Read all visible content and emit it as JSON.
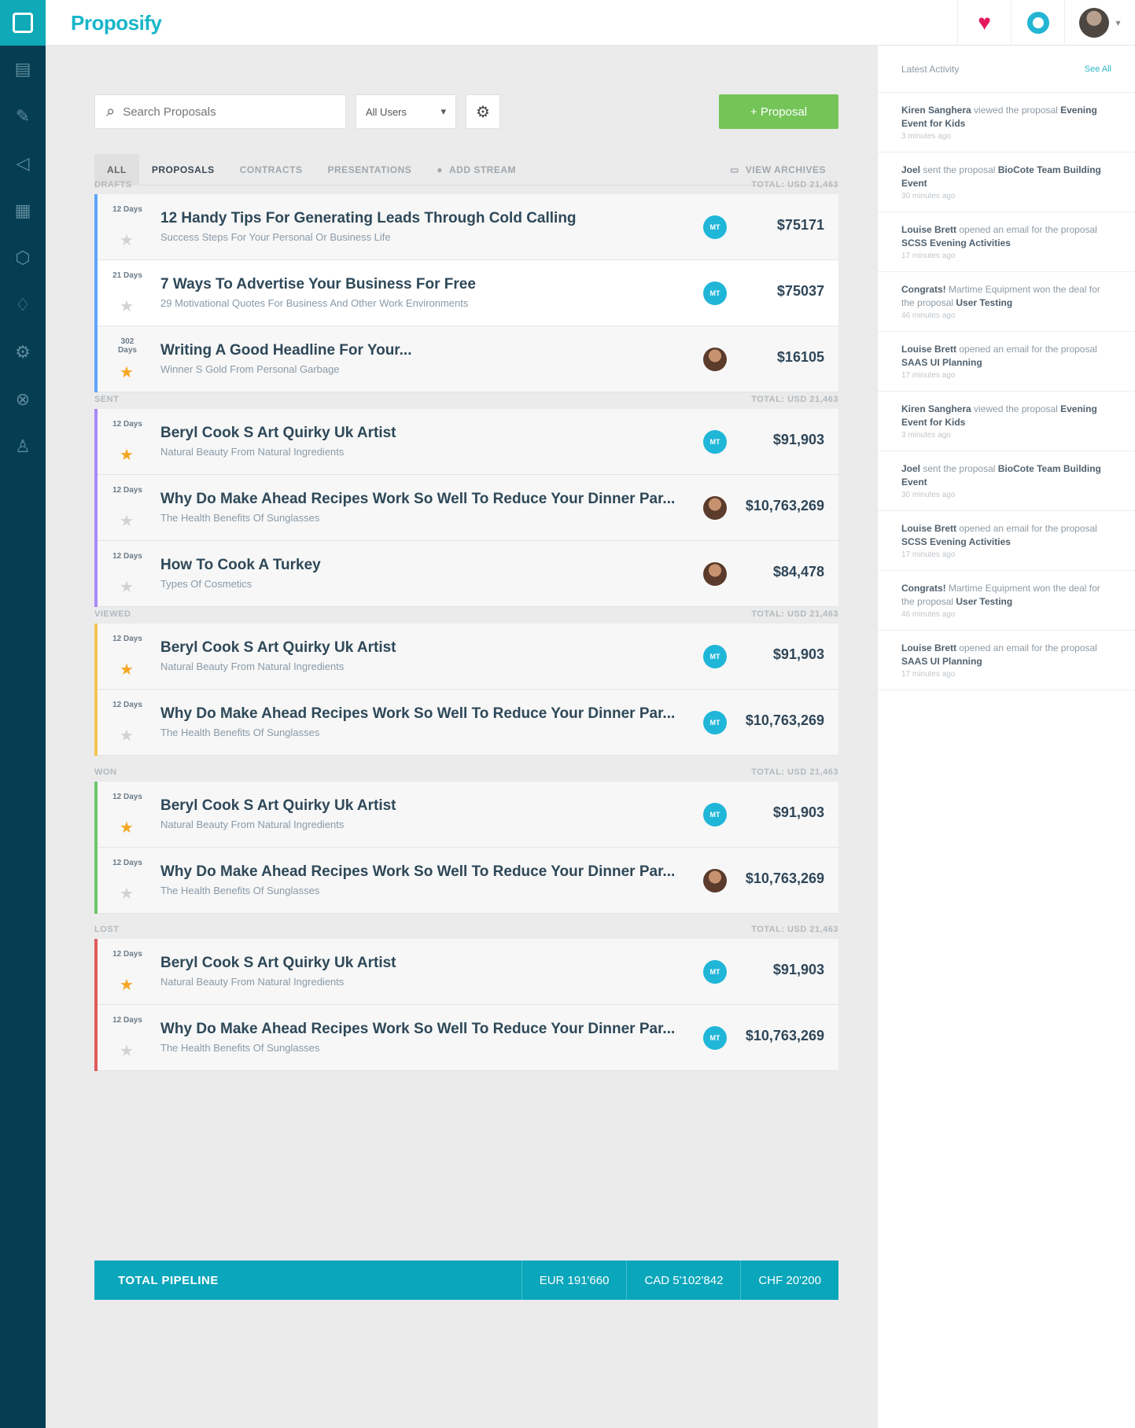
{
  "brand": "Proposify",
  "sidebar": {
    "icons": [
      "dashboard-icon",
      "pen-tool-icon",
      "megaphone-icon",
      "grid-icon",
      "box-icon",
      "lightbulb-icon",
      "settings-icon",
      "help-icon",
      "user-icon"
    ]
  },
  "toolbar": {
    "search_placeholder": "Search Proposals",
    "user_filter": "All Users",
    "new_button": "+ Proposal"
  },
  "tabs": [
    {
      "label": "ALL"
    },
    {
      "label": "PROPOSALS"
    },
    {
      "label": "CONTRACTS"
    },
    {
      "label": "PRESENTATIONS"
    },
    {
      "label": "ADD STREAM"
    },
    {
      "label": "VIEW ARCHIVES"
    }
  ],
  "groups": [
    {
      "name": "DRAFTS",
      "total": "TOTAL: USD 21,463",
      "color": "#60a5fa",
      "rows": [
        {
          "days": "12 Days",
          "title": "12 Handy Tips For Generating Leads Through Cold Calling",
          "subtitle": "Success Steps For Your Personal Or Business Life",
          "amount": "$75171",
          "starred": false,
          "owner": "MT"
        },
        {
          "days": "21 Days",
          "title": "7 Ways To Advertise Your Business For Free",
          "subtitle": "29 Motivational Quotes For Business And Other Work Environments",
          "amount": "$75037",
          "starred": false,
          "owner": "MT"
        },
        {
          "days": "302 Days",
          "title": "Writing A Good Headline For Your...",
          "subtitle": "Winner S Gold From Personal Garbage",
          "amount": "$16105",
          "starred": true,
          "owner": ""
        }
      ]
    },
    {
      "name": "SENT",
      "total": "TOTAL: USD 21,463",
      "color": "#a78bfa",
      "rows": [
        {
          "days": "12 Days",
          "title": "Beryl Cook S Art Quirky Uk Artist",
          "subtitle": "Natural Beauty From Natural Ingredients",
          "amount": "$91,903",
          "starred": true,
          "owner": "MT"
        },
        {
          "days": "12 Days",
          "title": "Why Do Make Ahead Recipes Work So Well To Reduce Your Dinner Par...",
          "subtitle": "The Health Benefits Of Sunglasses",
          "amount": "$10,763,269",
          "starred": false,
          "owner": ""
        },
        {
          "days": "12 Days",
          "title": "How To Cook A Turkey",
          "subtitle": "Types Of Cosmetics",
          "amount": "$84,478",
          "starred": false,
          "owner": ""
        }
      ]
    },
    {
      "name": "VIEWED",
      "total": "TOTAL: USD 21,463",
      "color": "#f5c451",
      "rows": [
        {
          "days": "12 Days",
          "title": "Beryl Cook S Art Quirky Uk Artist",
          "subtitle": "Natural Beauty From Natural Ingredients",
          "amount": "$91,903",
          "starred": true,
          "owner": "MT"
        },
        {
          "days": "12 Days",
          "title": "Why Do Make Ahead Recipes Work So Well To Reduce Your Dinner Par...",
          "subtitle": "The Health Benefits Of Sunglasses",
          "amount": "$10,763,269",
          "starred": false,
          "owner": "MT"
        }
      ]
    },
    {
      "name": "WON",
      "total": "TOTAL: USD 21,463",
      "color": "#6cc76a",
      "rows": [
        {
          "days": "12 Days",
          "title": "Beryl Cook S Art Quirky Uk Artist",
          "subtitle": "Natural Beauty From Natural Ingredients",
          "amount": "$91,903",
          "starred": true,
          "owner": "MT"
        },
        {
          "days": "12 Days",
          "title": "Why Do Make Ahead Recipes Work So Well To Reduce Your Dinner Par...",
          "subtitle": "The Health Benefits Of Sunglasses",
          "amount": "$10,763,269",
          "starred": false,
          "owner": ""
        }
      ]
    },
    {
      "name": "LOST",
      "total": "TOTAL: USD 21,463",
      "color": "#e05a5a",
      "rows": [
        {
          "days": "12 Days",
          "title": "Beryl Cook S Art Quirky Uk Artist",
          "subtitle": "Natural Beauty From Natural Ingredients",
          "amount": "$91,903",
          "starred": true,
          "owner": "MT"
        },
        {
          "days": "12 Days",
          "title": "Why Do Make Ahead Recipes Work So Well To Reduce Your Dinner Par...",
          "subtitle": "The Health Benefits Of Sunglasses",
          "amount": "$10,763,269",
          "starred": false,
          "owner": "MT"
        }
      ]
    }
  ],
  "pipeline": {
    "label": "TOTAL PIPELINE",
    "values": [
      "EUR 191'660",
      "CAD 5'102'842",
      "CHF 20'200"
    ]
  },
  "activity": {
    "title": "Latest Activity",
    "see_all": "See All",
    "items": [
      {
        "who": "Kiren Sanghera",
        "text": "viewed the proposal",
        "obj": "Evening Event for Kids",
        "time": "3 minutes ago"
      },
      {
        "who": "Joel",
        "text": "sent the proposal",
        "obj": "BioCote Team Building Event",
        "time": "30 minutes ago"
      },
      {
        "who": "Louise Brett",
        "text": "opened an email for the proposal",
        "obj": "SCSS Evening Activities",
        "time": "17 minutes ago"
      },
      {
        "who": "Congrats!",
        "text": "Martime Equipment won the deal for the proposal",
        "obj": "User Testing",
        "time": "46 minutes ago"
      },
      {
        "who": "Louise Brett",
        "text": "opened an email for the proposal",
        "obj": "SAAS UI Planning",
        "time": "17 minutes ago"
      },
      {
        "who": "Kiren Sanghera",
        "text": "viewed the proposal",
        "obj": "Evening Event for Kids",
        "time": "3 minutes ago"
      },
      {
        "who": "Joel",
        "text": "sent the proposal",
        "obj": "BioCote Team Building Event",
        "time": "30 minutes ago"
      },
      {
        "who": "Louise Brett",
        "text": "opened an email for the proposal",
        "obj": "SCSS Evening Activities",
        "time": "17 minutes ago"
      },
      {
        "who": "Congrats!",
        "text": "Martime Equipment won the deal for the proposal",
        "obj": "User Testing",
        "time": "46 minutes ago"
      },
      {
        "who": "Louise Brett",
        "text": "opened an email for the proposal",
        "obj": "SAAS UI Planning",
        "time": "17 minutes ago"
      }
    ]
  }
}
